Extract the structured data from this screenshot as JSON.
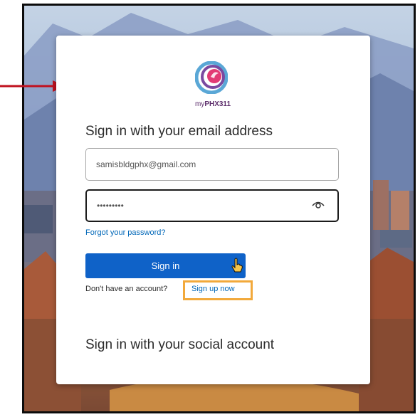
{
  "brand": {
    "prefix": "my",
    "name": "PHX311"
  },
  "login": {
    "heading": "Sign in with your email address",
    "email_value": "samisbldgphx@gmail.com",
    "password_masked": "•••••••••",
    "forgot_link": "Forgot your password?",
    "signin_button": "Sign in",
    "no_account_text": "Don't have an account?",
    "signup_link": "Sign up now",
    "social_heading": "Sign in with your social account"
  },
  "colors": {
    "primary_button": "#0f62c8",
    "link": "#0067b8",
    "highlight_box": "#f2a93b",
    "arrow": "#c0111f"
  },
  "icons": [
    "phoenix-logo-icon",
    "eye-icon",
    "hand-cursor-icon",
    "red-arrow-icon"
  ]
}
